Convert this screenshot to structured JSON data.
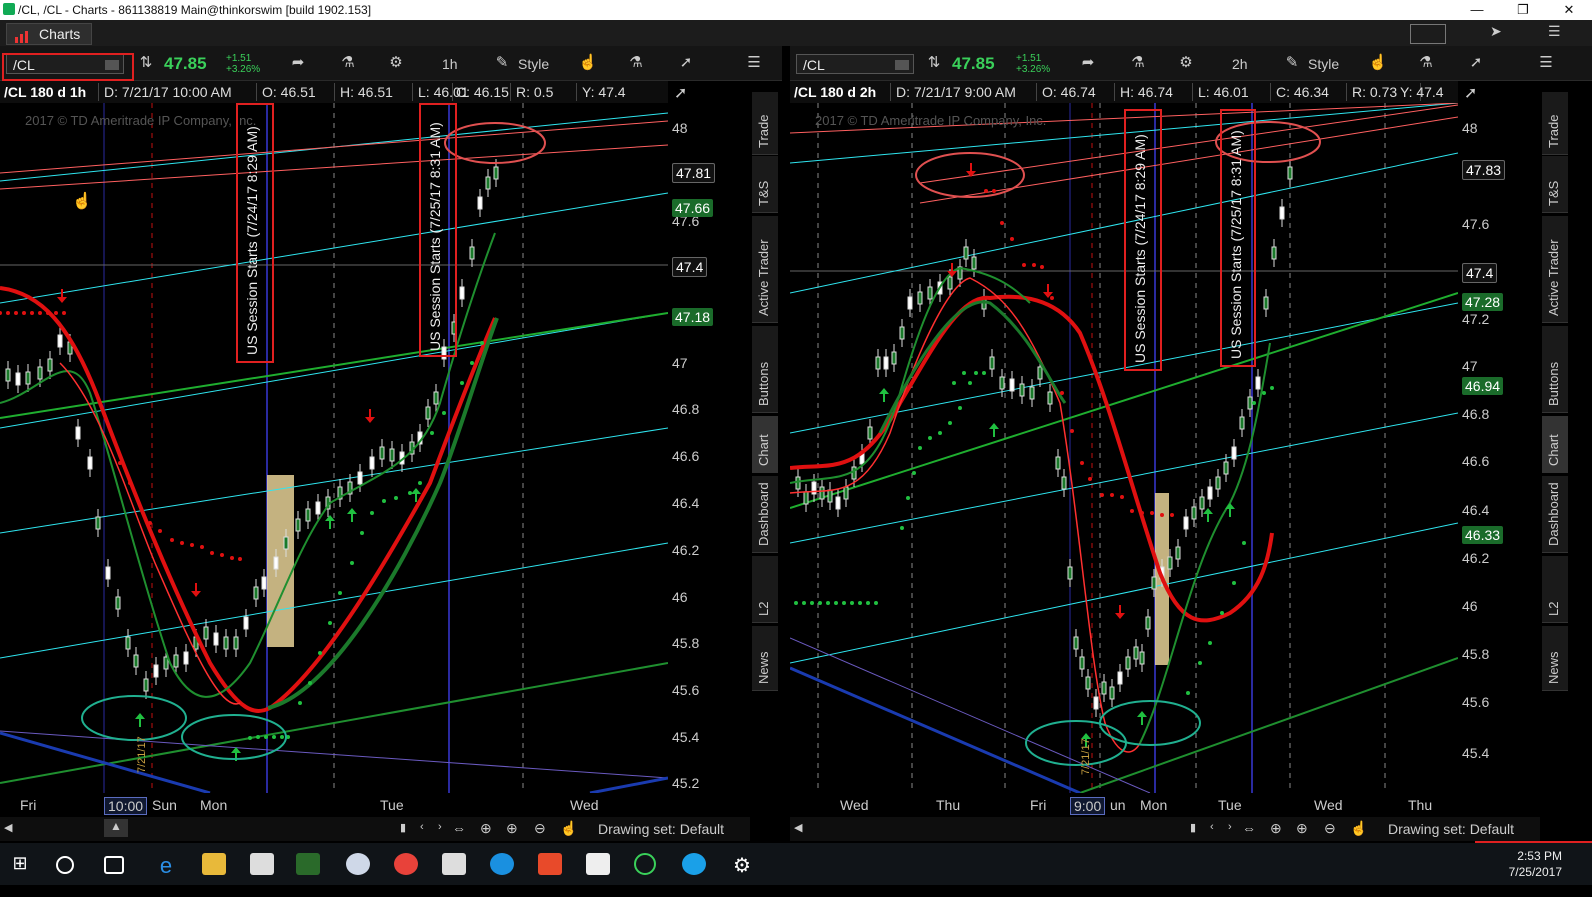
{
  "window": {
    "title": "/CL, /CL - Charts - 861138819 Main@thinkorswim [build 1902.153]"
  },
  "app": {
    "tab_label": "Charts"
  },
  "left": {
    "symbol": "/CL",
    "last": "47.85",
    "change": "+1.51",
    "change_pct": "+3.26%",
    "timeframe_btn": "1h",
    "style_btn": "Style",
    "info": {
      "title": "/CL 180 d 1h",
      "date": "D: 7/21/17 10:00 AM",
      "open": "O: 46.51",
      "high": "H: 46.51",
      "low": "L: 46.01",
      "close": "C: 46.15",
      "range": "R: 0.5",
      "y": "Y: 47.4"
    },
    "copyright": "2017 © TD Ameritrade IP Company, Inc.",
    "annotation1": "US Session Starts (7/24/17 8:29 AM)",
    "annotation2": "US Session Starts (7/25/17 8:31 AM)",
    "date_marker": "7/21/17",
    "y_ticks": [
      "48",
      "47.6",
      "47",
      "46.8",
      "46.6",
      "46.4",
      "46.2",
      "46",
      "45.8",
      "45.6",
      "45.4",
      "45.2"
    ],
    "price_badges": [
      {
        "label": "47.81",
        "kind": "dark"
      },
      {
        "label": "47.66",
        "kind": "green"
      },
      {
        "label": "47.4",
        "kind": "dark"
      },
      {
        "label": "47.18",
        "kind": "green"
      }
    ],
    "x_labels": [
      "Fri",
      "10:00",
      "Sun",
      "Mon",
      "Tue",
      "Wed"
    ],
    "drawing_set": "Drawing set: Default"
  },
  "right": {
    "symbol": "/CL",
    "last": "47.85",
    "change": "+1.51",
    "change_pct": "+3.26%",
    "timeframe_btn": "2h",
    "style_btn": "Style",
    "info": {
      "title": "/CL 180 d 2h",
      "date": "D: 7/21/17 9:00 AM",
      "open": "O: 46.74",
      "high": "H: 46.74",
      "low": "L: 46.01",
      "close": "C: 46.34",
      "range": "R: 0.73",
      "y": "Y: 47.4"
    },
    "copyright": "2017 © TD Ameritrade IP Company, Inc.",
    "annotation1": "US Session Starts (7/24/17 8:29 AM)",
    "annotation2": "US Session Starts (7/25/17 8:31 AM)",
    "date_marker": "7/21/17",
    "y_ticks": [
      "48",
      "47.6",
      "47.2",
      "47",
      "46.8",
      "46.6",
      "46.4",
      "46.2",
      "46",
      "45.8",
      "45.6",
      "45.4"
    ],
    "price_badges": [
      {
        "label": "47.83",
        "kind": "dark"
      },
      {
        "label": "47.4",
        "kind": "dark"
      },
      {
        "label": "47.28",
        "kind": "green"
      },
      {
        "label": "46.94",
        "kind": "green"
      },
      {
        "label": "46.33",
        "kind": "green"
      }
    ],
    "x_labels": [
      "Wed",
      "Thu",
      "Fri",
      "9:00",
      "un",
      "Mon",
      "Tue",
      "Wed",
      "Thu"
    ],
    "drawing_set": "Drawing set: Default"
  },
  "side_tabs": [
    "Trade",
    "T&S",
    "Active Trader",
    "Buttons",
    "Chart",
    "Dashboard",
    "L2",
    "News"
  ],
  "clock": {
    "time": "2:53 PM",
    "date": "7/25/2017"
  },
  "colors": {
    "accent_green": "#3ad05a",
    "ma_red": "#e01010",
    "ma_green": "#1f8f2f",
    "channel_cyan": "#2fe6f0",
    "session_line": "#2a2aa0",
    "annotation_box": "#e02020"
  }
}
